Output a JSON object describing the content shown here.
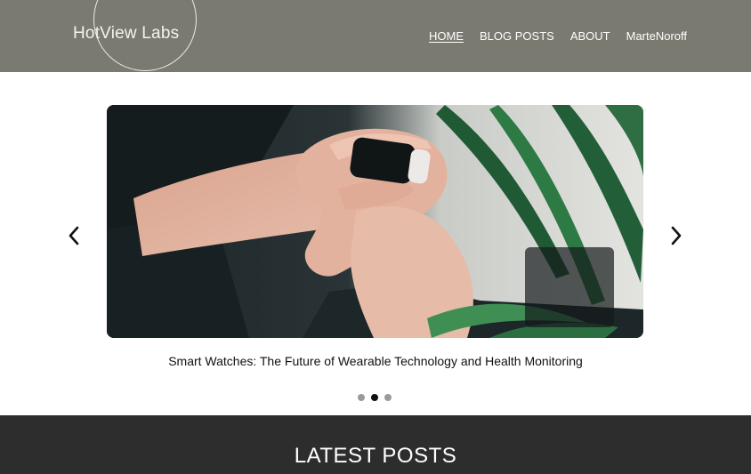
{
  "header": {
    "logo_text": "HotView Labs",
    "nav": [
      {
        "label": "HOME",
        "active": true
      },
      {
        "label": "BLOG POSTS",
        "active": false
      },
      {
        "label": "ABOUT",
        "active": false
      },
      {
        "label": "MarteNoroff",
        "active": false
      }
    ]
  },
  "carousel": {
    "image_description": "photo-icon",
    "caption": "Smart Watches: The Future of Wearable Technology and Health Monitoring",
    "prev_icon": "chevron-left-icon",
    "next_icon": "chevron-right-icon",
    "slide_count": 3,
    "active_index": 1
  },
  "latest": {
    "title": "LATEST POSTS"
  },
  "colors": {
    "header_bg": "#7b7a70",
    "footer_bg": "#2d2d2d",
    "active_dot": "#111111",
    "inactive_dot": "#9a9a9a"
  }
}
